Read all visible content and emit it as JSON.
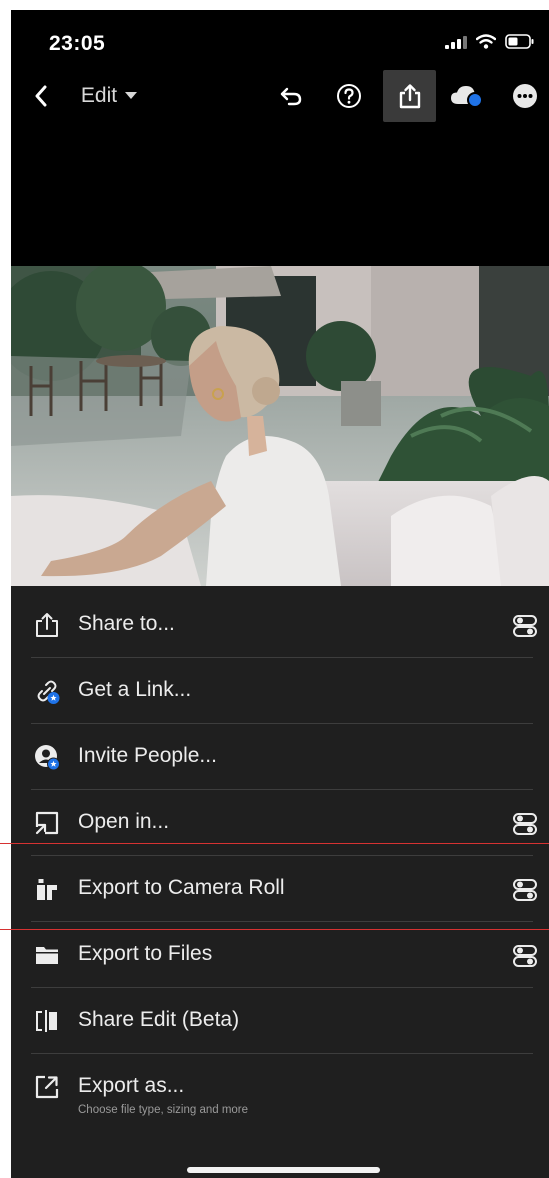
{
  "status_bar": {
    "time": "23:05"
  },
  "top_bar": {
    "edit_label": "Edit"
  },
  "menu": {
    "items": [
      {
        "label": "Share to...",
        "icon": "share-icon",
        "has_options": true
      },
      {
        "label": "Get a Link...",
        "icon": "link-icon",
        "has_options": false
      },
      {
        "label": "Invite People...",
        "icon": "invite-people-icon",
        "has_options": false
      },
      {
        "label": "Open in...",
        "icon": "open-in-icon",
        "has_options": true
      },
      {
        "label": "Export to Camera Roll",
        "icon": "camera-roll-icon",
        "has_options": true
      },
      {
        "label": "Export to Files",
        "icon": "folder-icon",
        "has_options": true
      },
      {
        "label": "Share Edit (Beta)",
        "icon": "share-edit-icon",
        "has_options": false
      },
      {
        "label": "Export as...",
        "sublabel": "Choose file type, sizing and more",
        "icon": "export-as-icon",
        "has_options": false
      }
    ]
  },
  "colors": {
    "sheet_bg": "#1f1f1f",
    "accent_blue": "#1f73e8",
    "divider": "#3d3d3d",
    "guide_line": "#d63232"
  }
}
